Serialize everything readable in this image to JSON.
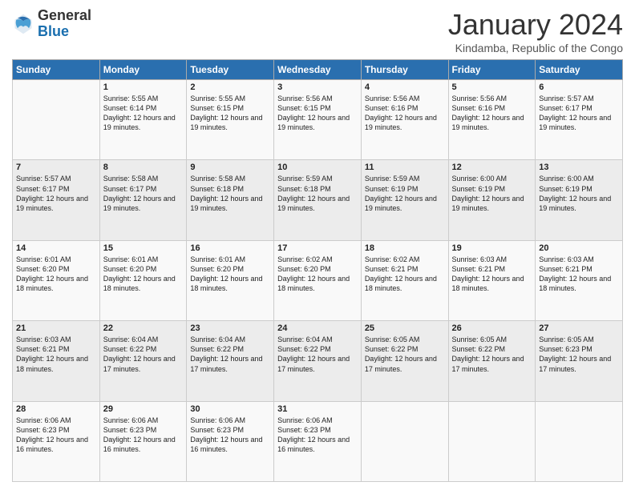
{
  "logo": {
    "general": "General",
    "blue": "Blue"
  },
  "header": {
    "month": "January 2024",
    "location": "Kindamba, Republic of the Congo"
  },
  "weekdays": [
    "Sunday",
    "Monday",
    "Tuesday",
    "Wednesday",
    "Thursday",
    "Friday",
    "Saturday"
  ],
  "weeks": [
    [
      {
        "day": "",
        "info": ""
      },
      {
        "day": "1",
        "info": "Sunrise: 5:55 AM\nSunset: 6:14 PM\nDaylight: 12 hours and 19 minutes."
      },
      {
        "day": "2",
        "info": "Sunrise: 5:55 AM\nSunset: 6:15 PM\nDaylight: 12 hours and 19 minutes."
      },
      {
        "day": "3",
        "info": "Sunrise: 5:56 AM\nSunset: 6:15 PM\nDaylight: 12 hours and 19 minutes."
      },
      {
        "day": "4",
        "info": "Sunrise: 5:56 AM\nSunset: 6:16 PM\nDaylight: 12 hours and 19 minutes."
      },
      {
        "day": "5",
        "info": "Sunrise: 5:56 AM\nSunset: 6:16 PM\nDaylight: 12 hours and 19 minutes."
      },
      {
        "day": "6",
        "info": "Sunrise: 5:57 AM\nSunset: 6:17 PM\nDaylight: 12 hours and 19 minutes."
      }
    ],
    [
      {
        "day": "7",
        "info": "Sunrise: 5:57 AM\nSunset: 6:17 PM\nDaylight: 12 hours and 19 minutes."
      },
      {
        "day": "8",
        "info": "Sunrise: 5:58 AM\nSunset: 6:17 PM\nDaylight: 12 hours and 19 minutes."
      },
      {
        "day": "9",
        "info": "Sunrise: 5:58 AM\nSunset: 6:18 PM\nDaylight: 12 hours and 19 minutes."
      },
      {
        "day": "10",
        "info": "Sunrise: 5:59 AM\nSunset: 6:18 PM\nDaylight: 12 hours and 19 minutes."
      },
      {
        "day": "11",
        "info": "Sunrise: 5:59 AM\nSunset: 6:19 PM\nDaylight: 12 hours and 19 minutes."
      },
      {
        "day": "12",
        "info": "Sunrise: 6:00 AM\nSunset: 6:19 PM\nDaylight: 12 hours and 19 minutes."
      },
      {
        "day": "13",
        "info": "Sunrise: 6:00 AM\nSunset: 6:19 PM\nDaylight: 12 hours and 19 minutes."
      }
    ],
    [
      {
        "day": "14",
        "info": "Sunrise: 6:01 AM\nSunset: 6:20 PM\nDaylight: 12 hours and 18 minutes."
      },
      {
        "day": "15",
        "info": "Sunrise: 6:01 AM\nSunset: 6:20 PM\nDaylight: 12 hours and 18 minutes."
      },
      {
        "day": "16",
        "info": "Sunrise: 6:01 AM\nSunset: 6:20 PM\nDaylight: 12 hours and 18 minutes."
      },
      {
        "day": "17",
        "info": "Sunrise: 6:02 AM\nSunset: 6:20 PM\nDaylight: 12 hours and 18 minutes."
      },
      {
        "day": "18",
        "info": "Sunrise: 6:02 AM\nSunset: 6:21 PM\nDaylight: 12 hours and 18 minutes."
      },
      {
        "day": "19",
        "info": "Sunrise: 6:03 AM\nSunset: 6:21 PM\nDaylight: 12 hours and 18 minutes."
      },
      {
        "day": "20",
        "info": "Sunrise: 6:03 AM\nSunset: 6:21 PM\nDaylight: 12 hours and 18 minutes."
      }
    ],
    [
      {
        "day": "21",
        "info": "Sunrise: 6:03 AM\nSunset: 6:21 PM\nDaylight: 12 hours and 18 minutes."
      },
      {
        "day": "22",
        "info": "Sunrise: 6:04 AM\nSunset: 6:22 PM\nDaylight: 12 hours and 17 minutes."
      },
      {
        "day": "23",
        "info": "Sunrise: 6:04 AM\nSunset: 6:22 PM\nDaylight: 12 hours and 17 minutes."
      },
      {
        "day": "24",
        "info": "Sunrise: 6:04 AM\nSunset: 6:22 PM\nDaylight: 12 hours and 17 minutes."
      },
      {
        "day": "25",
        "info": "Sunrise: 6:05 AM\nSunset: 6:22 PM\nDaylight: 12 hours and 17 minutes."
      },
      {
        "day": "26",
        "info": "Sunrise: 6:05 AM\nSunset: 6:22 PM\nDaylight: 12 hours and 17 minutes."
      },
      {
        "day": "27",
        "info": "Sunrise: 6:05 AM\nSunset: 6:23 PM\nDaylight: 12 hours and 17 minutes."
      }
    ],
    [
      {
        "day": "28",
        "info": "Sunrise: 6:06 AM\nSunset: 6:23 PM\nDaylight: 12 hours and 16 minutes."
      },
      {
        "day": "29",
        "info": "Sunrise: 6:06 AM\nSunset: 6:23 PM\nDaylight: 12 hours and 16 minutes."
      },
      {
        "day": "30",
        "info": "Sunrise: 6:06 AM\nSunset: 6:23 PM\nDaylight: 12 hours and 16 minutes."
      },
      {
        "day": "31",
        "info": "Sunrise: 6:06 AM\nSunset: 6:23 PM\nDaylight: 12 hours and 16 minutes."
      },
      {
        "day": "",
        "info": ""
      },
      {
        "day": "",
        "info": ""
      },
      {
        "day": "",
        "info": ""
      }
    ]
  ]
}
